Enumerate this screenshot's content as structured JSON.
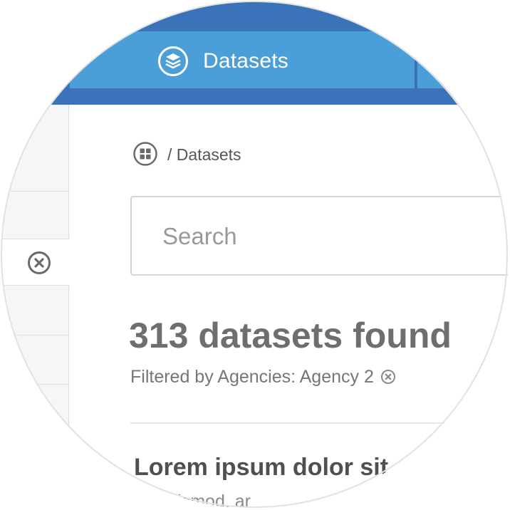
{
  "nav": {
    "active_tab": {
      "label": "Datasets",
      "icon": "layers-icon"
    }
  },
  "sidebar": {
    "active_item_icon": "close-circle-icon"
  },
  "breadcrumb": {
    "home_icon": "grid-home-icon",
    "path": "/ Datasets"
  },
  "search": {
    "placeholder": "Search",
    "value": ""
  },
  "results": {
    "title": "313 datasets found",
    "filter_label": "Filtered by Agencies: Agency 2",
    "filter_remove_icon": "close-circle-icon"
  },
  "items": [
    {
      "title": "Lorem ipsum dolor sit",
      "description": "us euismod, ar"
    }
  ],
  "colors": {
    "header_dark": "#3b73b8",
    "header_tab": "#4a9fd9",
    "text_muted": "#767676",
    "title_gray": "#6e6e6e"
  }
}
